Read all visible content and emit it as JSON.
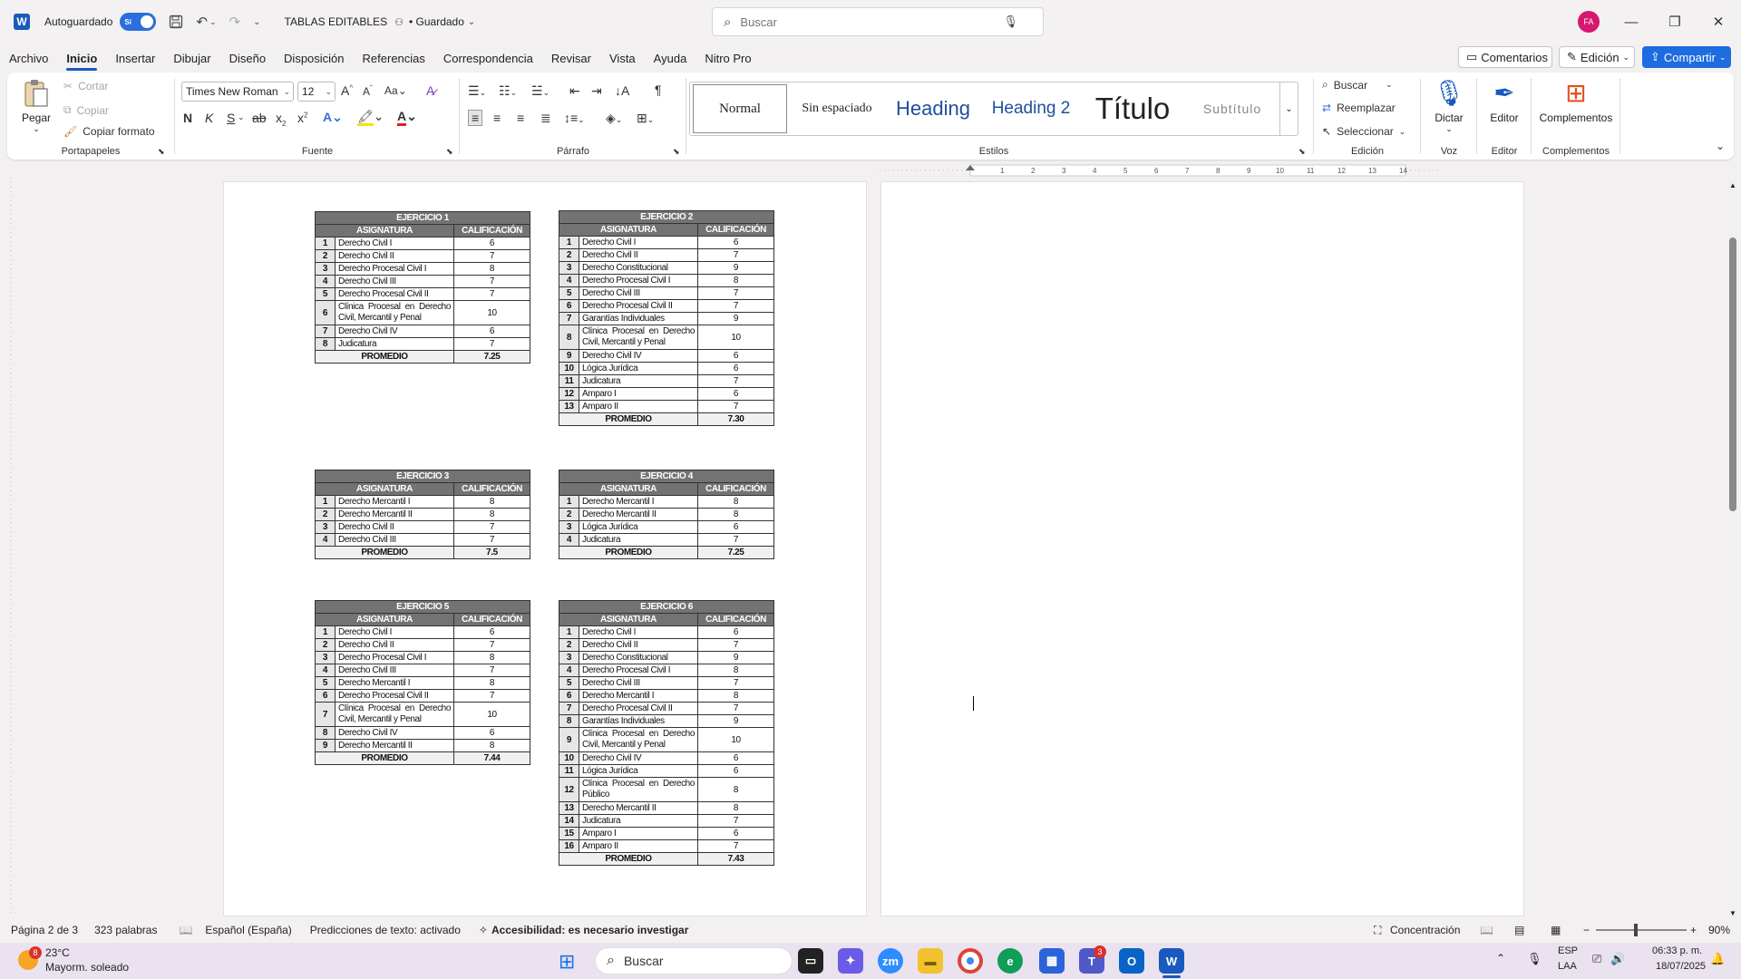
{
  "titlebar": {
    "autosave_label": "Autoguardado",
    "autosave_state": "Sí",
    "doc_title": "TABLAS EDITABLES",
    "saved_status": "• Guardado",
    "search_placeholder": "Buscar",
    "user_initials": "FA"
  },
  "menu": {
    "tabs": [
      "Archivo",
      "Inicio",
      "Insertar",
      "Dibujar",
      "Diseño",
      "Disposición",
      "Referencias",
      "Correspondencia",
      "Revisar",
      "Vista",
      "Ayuda",
      "Nitro Pro"
    ],
    "comments": "Comentarios",
    "editing": "Edición",
    "share": "Compartir"
  },
  "ribbon": {
    "clipboard": {
      "paste": "Pegar",
      "cut": "Cortar",
      "copy": "Copiar",
      "format_painter": "Copiar formato",
      "label": "Portapapeles"
    },
    "font": {
      "name": "Times New Roman",
      "size": "12",
      "label": "Fuente",
      "case": "Aa",
      "bold": "N",
      "italic": "K",
      "underline": "S"
    },
    "paragraph": {
      "label": "Párrafo"
    },
    "styles": {
      "items": [
        "Normal",
        "Sin espaciado",
        "Heading",
        "Heading 2",
        "Título",
        "Subtítulo"
      ],
      "label": "Estilos"
    },
    "editing": {
      "find": "Buscar",
      "replace": "Reemplazar",
      "select": "Seleccionar",
      "label": "Edición"
    },
    "voice": {
      "dictate": "Dictar",
      "label": "Voz"
    },
    "editor": {
      "name": "Editor",
      "label": "Editor"
    },
    "addins": {
      "name": "Complementos",
      "label": "Complementos"
    }
  },
  "document": {
    "header_label": "ASIGNATURA",
    "header_value": "CALIFICACIÓN",
    "average_label": "PROMEDIO",
    "exercises": [
      {
        "title": "EJERCICIO 1",
        "rows": [
          [
            "1",
            "Derecho Civil I",
            "6"
          ],
          [
            "2",
            "Derecho Civil II",
            "7"
          ],
          [
            "3",
            "Derecho Procesal Civil I",
            "8"
          ],
          [
            "4",
            "Derecho Civil III",
            "7"
          ],
          [
            "5",
            "Derecho Procesal Civil II",
            "7"
          ],
          [
            "6",
            "Clínica Procesal en Derecho Civil, Mercantil y Penal",
            "10"
          ],
          [
            "7",
            "Derecho Civil IV",
            "6"
          ],
          [
            "8",
            "Judicatura",
            "7"
          ]
        ],
        "average": "7.25"
      },
      {
        "title": "EJERCICIO 2",
        "rows": [
          [
            "1",
            "Derecho Civil I",
            "6"
          ],
          [
            "2",
            "Derecho Civil II",
            "7"
          ],
          [
            "3",
            "Derecho Constitucional",
            "9"
          ],
          [
            "4",
            "Derecho Procesal Civil I",
            "8"
          ],
          [
            "5",
            "Derecho Civil III",
            "7"
          ],
          [
            "6",
            "Derecho Procesal Civil II",
            "7"
          ],
          [
            "7",
            "Garantías Individuales",
            "9"
          ],
          [
            "8",
            "Clínica Procesal en Derecho Civil, Mercantil y Penal",
            "10"
          ],
          [
            "9",
            "Derecho Civil IV",
            "6"
          ],
          [
            "10",
            "Lógica Jurídica",
            "6"
          ],
          [
            "11",
            "Judicatura",
            "7"
          ],
          [
            "12",
            "Amparo I",
            "6"
          ],
          [
            "13",
            "Amparo II",
            "7"
          ]
        ],
        "average": "7.30"
      },
      {
        "title": "EJERCICIO 3",
        "rows": [
          [
            "1",
            "Derecho Mercantil I",
            "8"
          ],
          [
            "2",
            "Derecho Mercantil II",
            "8"
          ],
          [
            "3",
            "Derecho Civil II",
            "7"
          ],
          [
            "4",
            "Derecho Civil III",
            "7"
          ]
        ],
        "average": "7.5"
      },
      {
        "title": "EJERCICIO 4",
        "rows": [
          [
            "1",
            "Derecho Mercantil I",
            "8"
          ],
          [
            "2",
            "Derecho Mercantil II",
            "8"
          ],
          [
            "3",
            "Lógica Jurídica",
            "6"
          ],
          [
            "4",
            "Judicatura",
            "7"
          ]
        ],
        "average": "7.25"
      },
      {
        "title": "EJERCICIO 5",
        "rows": [
          [
            "1",
            "Derecho Civil I",
            "6"
          ],
          [
            "2",
            "Derecho Civil II",
            "7"
          ],
          [
            "3",
            "Derecho Procesal Civil I",
            "8"
          ],
          [
            "4",
            "Derecho Civil III",
            "7"
          ],
          [
            "5",
            "Derecho Mercantil I",
            "8"
          ],
          [
            "6",
            "Derecho Procesal Civil II",
            "7"
          ],
          [
            "7",
            "Clínica Procesal en Derecho Civil, Mercantil y Penal",
            "10"
          ],
          [
            "8",
            "Derecho Civil IV",
            "6"
          ],
          [
            "9",
            "Derecho Mercantil II",
            "8"
          ]
        ],
        "average": "7.44"
      },
      {
        "title": "EJERCICIO 6",
        "rows": [
          [
            "1",
            "Derecho Civil I",
            "6"
          ],
          [
            "2",
            "Derecho Civil II",
            "7"
          ],
          [
            "3",
            "Derecho Constitucional",
            "9"
          ],
          [
            "4",
            "Derecho Procesal Civil I",
            "8"
          ],
          [
            "5",
            "Derecho Civil III",
            "7"
          ],
          [
            "6",
            "Derecho Mercantil I",
            "8"
          ],
          [
            "7",
            "Derecho Procesal Civil II",
            "7"
          ],
          [
            "8",
            "Garantías Individuales",
            "9"
          ],
          [
            "9",
            "Clínica Procesal en Derecho Civil, Mercantil y Penal",
            "10"
          ],
          [
            "10",
            "Derecho Civil IV",
            "6"
          ],
          [
            "11",
            "Lógica Jurídica",
            "6"
          ],
          [
            "12",
            "Clínica Procesal en Derecho Público",
            "8"
          ],
          [
            "13",
            "Derecho Mercantil II",
            "8"
          ],
          [
            "14",
            "Judicatura",
            "7"
          ],
          [
            "15",
            "Amparo I",
            "6"
          ],
          [
            "16",
            "Amparo II",
            "7"
          ]
        ],
        "average": "7.43"
      }
    ]
  },
  "status": {
    "page": "Página 2 de 3",
    "words": "323 palabras",
    "language": "Español (España)",
    "predictions": "Predicciones de texto: activado",
    "accessibility": "Accesibilidad: es necesario investigar",
    "focus": "Concentración",
    "zoom": "90%"
  },
  "taskbar": {
    "temp": "23°C",
    "weather": "Mayorm. soleado",
    "weather_badge": "8",
    "search": "Buscar",
    "teams_badge": "3",
    "lang_1": "ESP",
    "lang_2": "LAA",
    "time": "06:33 p. m.",
    "date": "18/07/2025"
  },
  "colors": {
    "accent": "#185abd",
    "table_header": "#737373",
    "share_button": "#1d6ce0"
  }
}
